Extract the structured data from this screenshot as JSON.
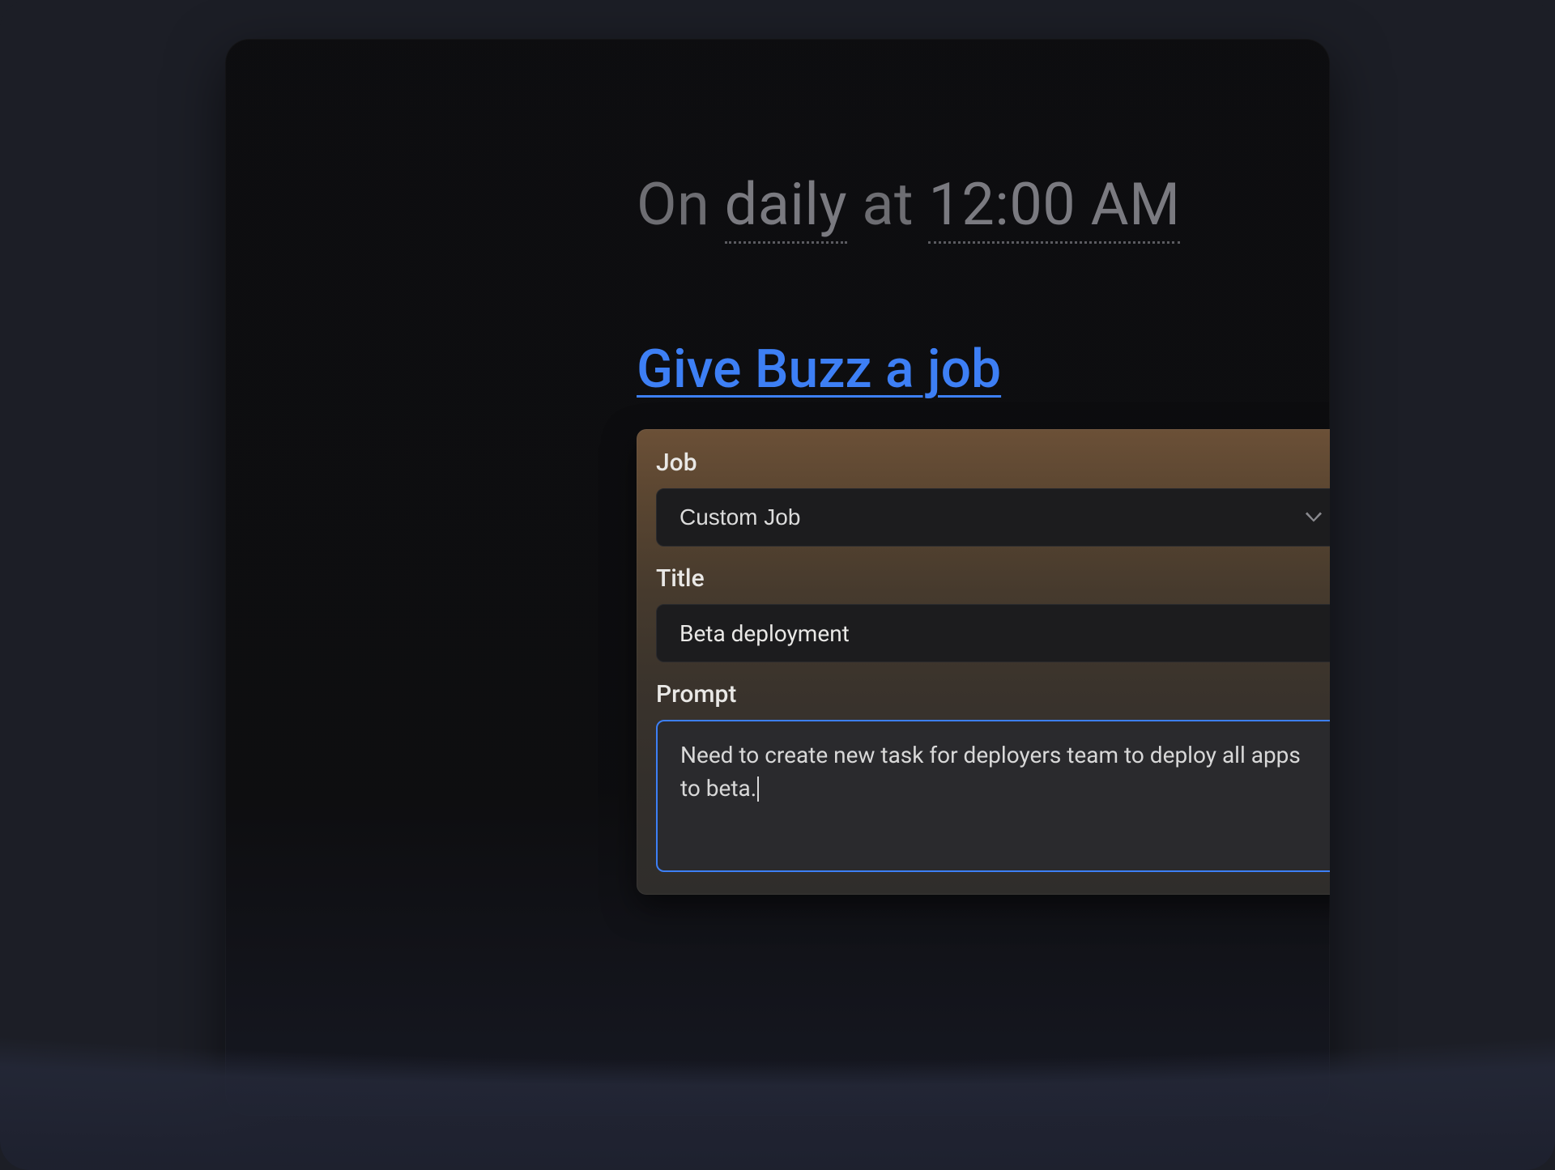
{
  "schedule": {
    "prefix": "On ",
    "frequency": "daily",
    "separator": " at ",
    "time": "12:00 AM"
  },
  "action": {
    "label": "Give Buzz a job"
  },
  "form": {
    "job": {
      "label": "Job",
      "selected": "Custom Job"
    },
    "title": {
      "label": "Title",
      "value": "Beta deployment"
    },
    "prompt": {
      "label": "Prompt",
      "value": "Need to create new task for deployers team to deploy all apps to beta."
    }
  },
  "colors": {
    "accent": "#3d7ff5",
    "background": "#1c1e26",
    "card_grad_top": "#6b5037",
    "card_grad_bottom": "#2f2d2b"
  }
}
